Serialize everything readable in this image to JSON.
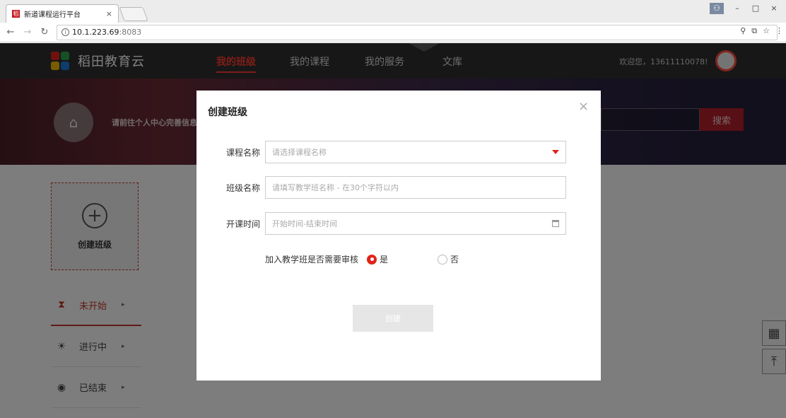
{
  "browser": {
    "tab_title": "新道课程运行平台",
    "tab_close": "×",
    "url_host": "10.1.223.69",
    "url_port": ":8083",
    "window_controls": [
      "–",
      "□",
      "×"
    ]
  },
  "site": {
    "logo_text": "稻田教育云",
    "nav": [
      "我的班级",
      "我的课程",
      "我的服务",
      "文库"
    ],
    "welcome": "欢迎您，13611110078!",
    "banner_text": "请前往个人中心完善信息",
    "search_label": "搜索"
  },
  "sidebar": {
    "create_label": "创建班级",
    "status_items": [
      {
        "label": "未开始",
        "icon": "hourglass-icon"
      },
      {
        "label": "进行中",
        "icon": "sun-icon"
      },
      {
        "label": "已结束",
        "icon": "circle-dot-icon"
      }
    ]
  },
  "modal": {
    "title": "创建班级",
    "close": "×",
    "course_label": "课程名称",
    "course_placeholder": "请选择课程名称",
    "class_label": "班级名称",
    "class_placeholder": "请填写教学班名称 - 在30个字符以内",
    "time_label": "开课时间",
    "time_placeholder": "开始时间-结束时间",
    "audit_label": "加入教学班是否需要审核",
    "audit_yes": "是",
    "audit_no": "否",
    "audit_selected": "是",
    "submit_label": "创建"
  },
  "colors": {
    "accent": "#e2231a",
    "nav_bg": "#2f2f2f"
  }
}
